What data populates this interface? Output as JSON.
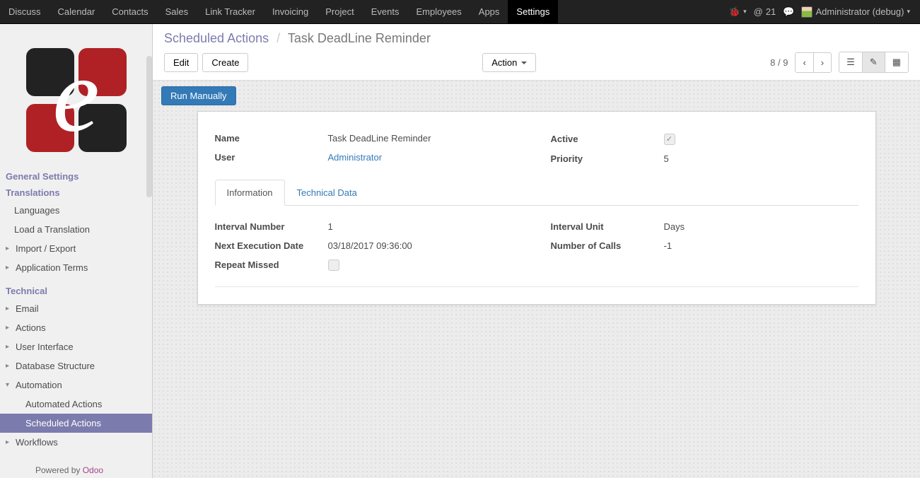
{
  "navbar": {
    "items": [
      "Discuss",
      "Calendar",
      "Contacts",
      "Sales",
      "Link Tracker",
      "Invoicing",
      "Project",
      "Events",
      "Employees",
      "Apps",
      "Settings"
    ],
    "active_index": 10,
    "msg_count": "21",
    "user_label": "Administrator (debug)"
  },
  "sidebar": {
    "general_settings": "General Settings",
    "translations": "Translations",
    "languages": "Languages",
    "load_translation": "Load a Translation",
    "import_export": "Import / Export",
    "application_terms": "Application Terms",
    "technical": "Technical",
    "email": "Email",
    "actions": "Actions",
    "user_interface": "User Interface",
    "database_structure": "Database Structure",
    "automation": "Automation",
    "automated_actions": "Automated Actions",
    "scheduled_actions": "Scheduled Actions",
    "workflows": "Workflows",
    "powered_by": "Powered by ",
    "powered_by_brand": "Odoo"
  },
  "breadcrumb": {
    "parent": "Scheduled Actions",
    "current": "Task DeadLine Reminder"
  },
  "toolbar": {
    "edit": "Edit",
    "create": "Create",
    "action": "Action",
    "pager": "8 / 9",
    "run_manually": "Run Manually"
  },
  "form": {
    "name_label": "Name",
    "name_value": "Task DeadLine Reminder",
    "user_label": "User",
    "user_value": "Administrator",
    "active_label": "Active",
    "active_checked": true,
    "priority_label": "Priority",
    "priority_value": "5",
    "tabs": [
      "Information",
      "Technical Data"
    ],
    "active_tab": 0,
    "interval_number_label": "Interval Number",
    "interval_number_value": "1",
    "interval_unit_label": "Interval Unit",
    "interval_unit_value": "Days",
    "next_exec_label": "Next Execution Date",
    "next_exec_value": "03/18/2017 09:36:00",
    "num_calls_label": "Number of Calls",
    "num_calls_value": "-1",
    "repeat_missed_label": "Repeat Missed",
    "repeat_missed_checked": false
  }
}
